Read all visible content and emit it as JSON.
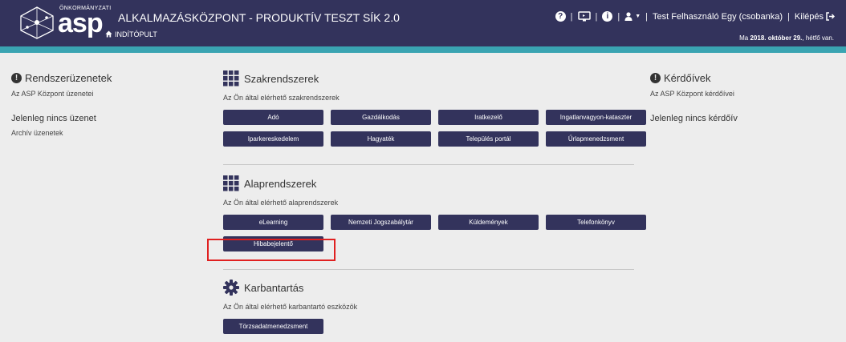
{
  "header": {
    "logo_small_text": "ÖNKORMÁNYZATI",
    "logo_text": "asp",
    "app_title": "ALKALMAZÁSKÖZPONT - PRODUKTÍV TESZT SÍK 2.0",
    "home_label": "INDÍTÓPULT",
    "user_label": "Test Felhasználó Egy (csobanka)",
    "logout_label": "Kilépés",
    "date_prefix": "Ma",
    "date_value": "2018. október 29.",
    "date_suffix": ", hétfő van."
  },
  "left": {
    "title": "Rendszerüzenetek",
    "subtitle": "Az ASP Központ üzenetei",
    "empty_text": "Jelenleg nincs üzenet",
    "archive_link": "Archív üzenetek"
  },
  "right": {
    "title": "Kérdőívek",
    "subtitle": "Az ASP Központ kérdőívei",
    "empty_text": "Jelenleg nincs kérdőív"
  },
  "sections": {
    "szak": {
      "title": "Szakrendszerek",
      "subtitle": "Az Ön által elérhető szakrendszerek",
      "buttons": [
        "Adó",
        "Gazdálkodás",
        "Iratkezelő",
        "Ingatlanvagyon-kataszter",
        "Iparkereskedelem",
        "Hagyaték",
        "Település portál",
        "Űrlapmenedzsment"
      ]
    },
    "alap": {
      "title": "Alaprendszerek",
      "subtitle": "Az Ön által elérhető alaprendszerek",
      "buttons": [
        "eLearning",
        "Nemzeti Jogszabálytár",
        "Küldemények",
        "Telefonkönyv",
        "Hibabejelentő"
      ]
    },
    "karb": {
      "title": "Karbantartás",
      "subtitle": "Az Ön által elérhető karbantartó eszközök",
      "buttons": [
        "Törzsadatmenedzsment"
      ]
    }
  },
  "colors": {
    "header_bg": "#33335c",
    "accent": "#3aa4b2",
    "button_bg": "#33335c",
    "highlight": "#e02020"
  },
  "icons": [
    "asp-logo-icon",
    "home-icon",
    "question-icon",
    "monitor-icon",
    "info-icon",
    "user-icon",
    "logout-icon",
    "grid-icon",
    "gear-icon",
    "exclamation-icon"
  ]
}
